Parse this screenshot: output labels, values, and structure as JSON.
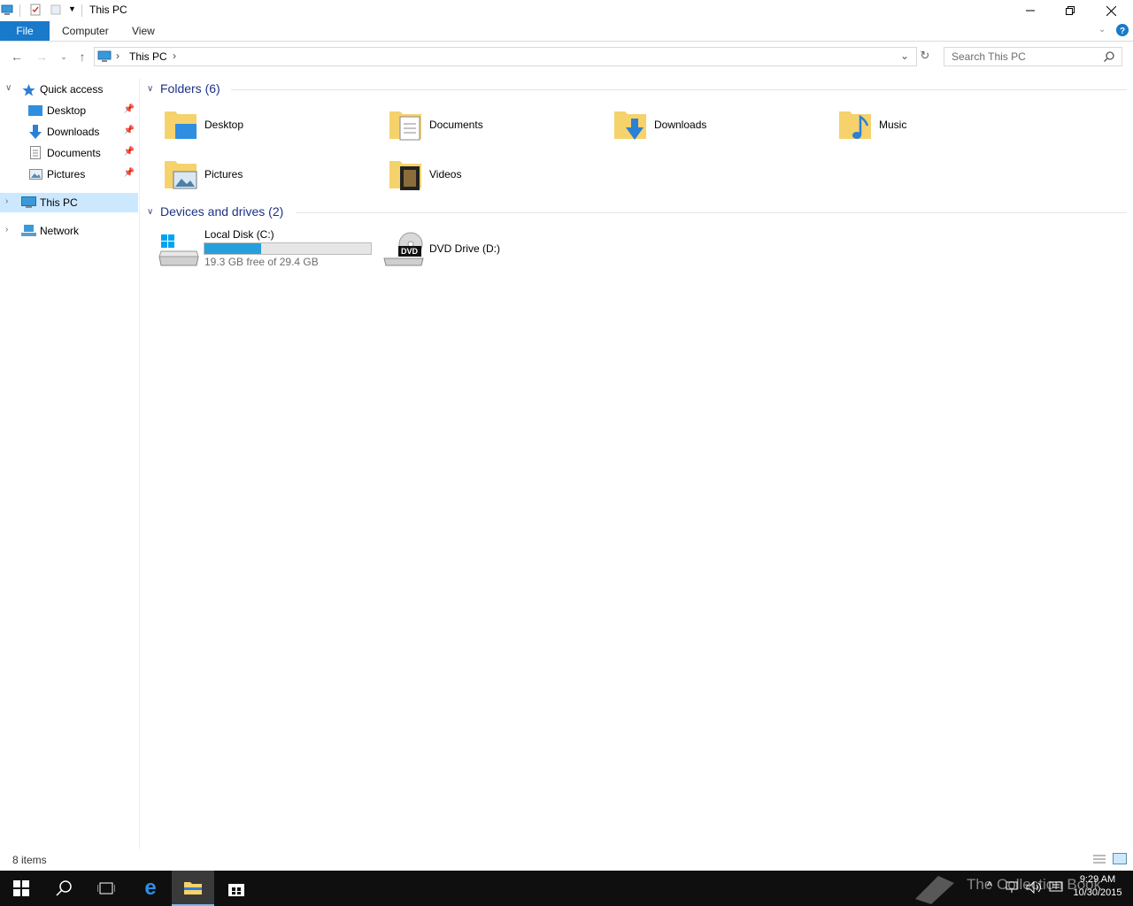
{
  "window": {
    "title": "This PC"
  },
  "ribbon": {
    "tabs": [
      "File",
      "Computer",
      "View"
    ]
  },
  "address": {
    "crumbs": [
      "This PC"
    ]
  },
  "search": {
    "placeholder": "Search This PC"
  },
  "sidebar": {
    "quick_access": "Quick access",
    "pinned": [
      "Desktop",
      "Downloads",
      "Documents",
      "Pictures"
    ],
    "this_pc": "This PC",
    "network": "Network"
  },
  "folders": {
    "header": "Folders (6)",
    "items": [
      "Desktop",
      "Documents",
      "Downloads",
      "Music",
      "Pictures",
      "Videos"
    ]
  },
  "drives": {
    "header": "Devices and drives (2)",
    "local": {
      "name": "Local Disk (C:)",
      "free": "19.3 GB free of 29.4 GB",
      "used_fraction": 0.34
    },
    "dvd": {
      "name": "DVD Drive (D:)",
      "badge": "DVD"
    }
  },
  "status": {
    "items": "8 items"
  },
  "taskbar": {
    "time": "9:29 AM",
    "date": "10/30/2015",
    "watermark": "The Collection Book"
  },
  "colors": {
    "accent": "#1979ca",
    "selected": "#cce8ff",
    "folder": "#f5d26b",
    "bar": "#26a0da"
  }
}
